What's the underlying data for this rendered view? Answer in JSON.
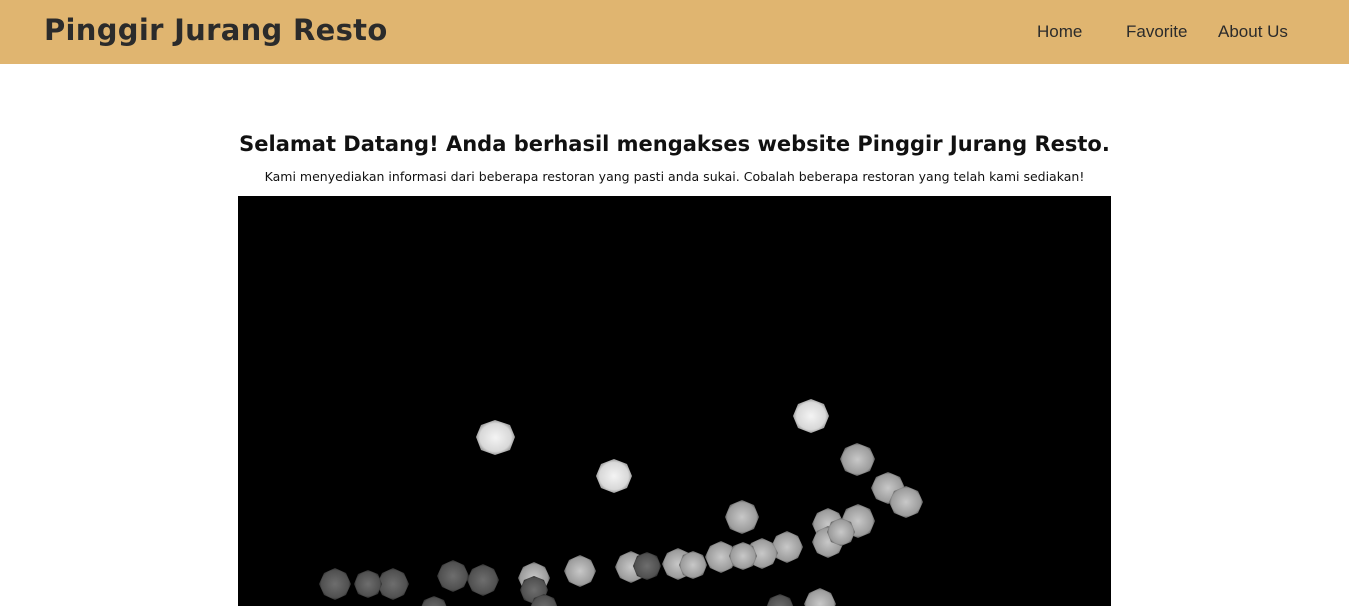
{
  "navbar": {
    "brand": "Pinggir Jurang Resto",
    "links": [
      {
        "label": "Home"
      },
      {
        "label": "Favorite"
      },
      {
        "label": "About Us"
      }
    ],
    "background_color": "#e0b570"
  },
  "hero": {
    "title": "Selamat Datang! Anda berhasil mengakses website Pinggir Jurang Resto.",
    "subtitle": "Kami menyediakan informasi dari beberapa restoran yang pasti anda sukai. Cobalah beberapa restoran yang telah kami sediakan!"
  }
}
